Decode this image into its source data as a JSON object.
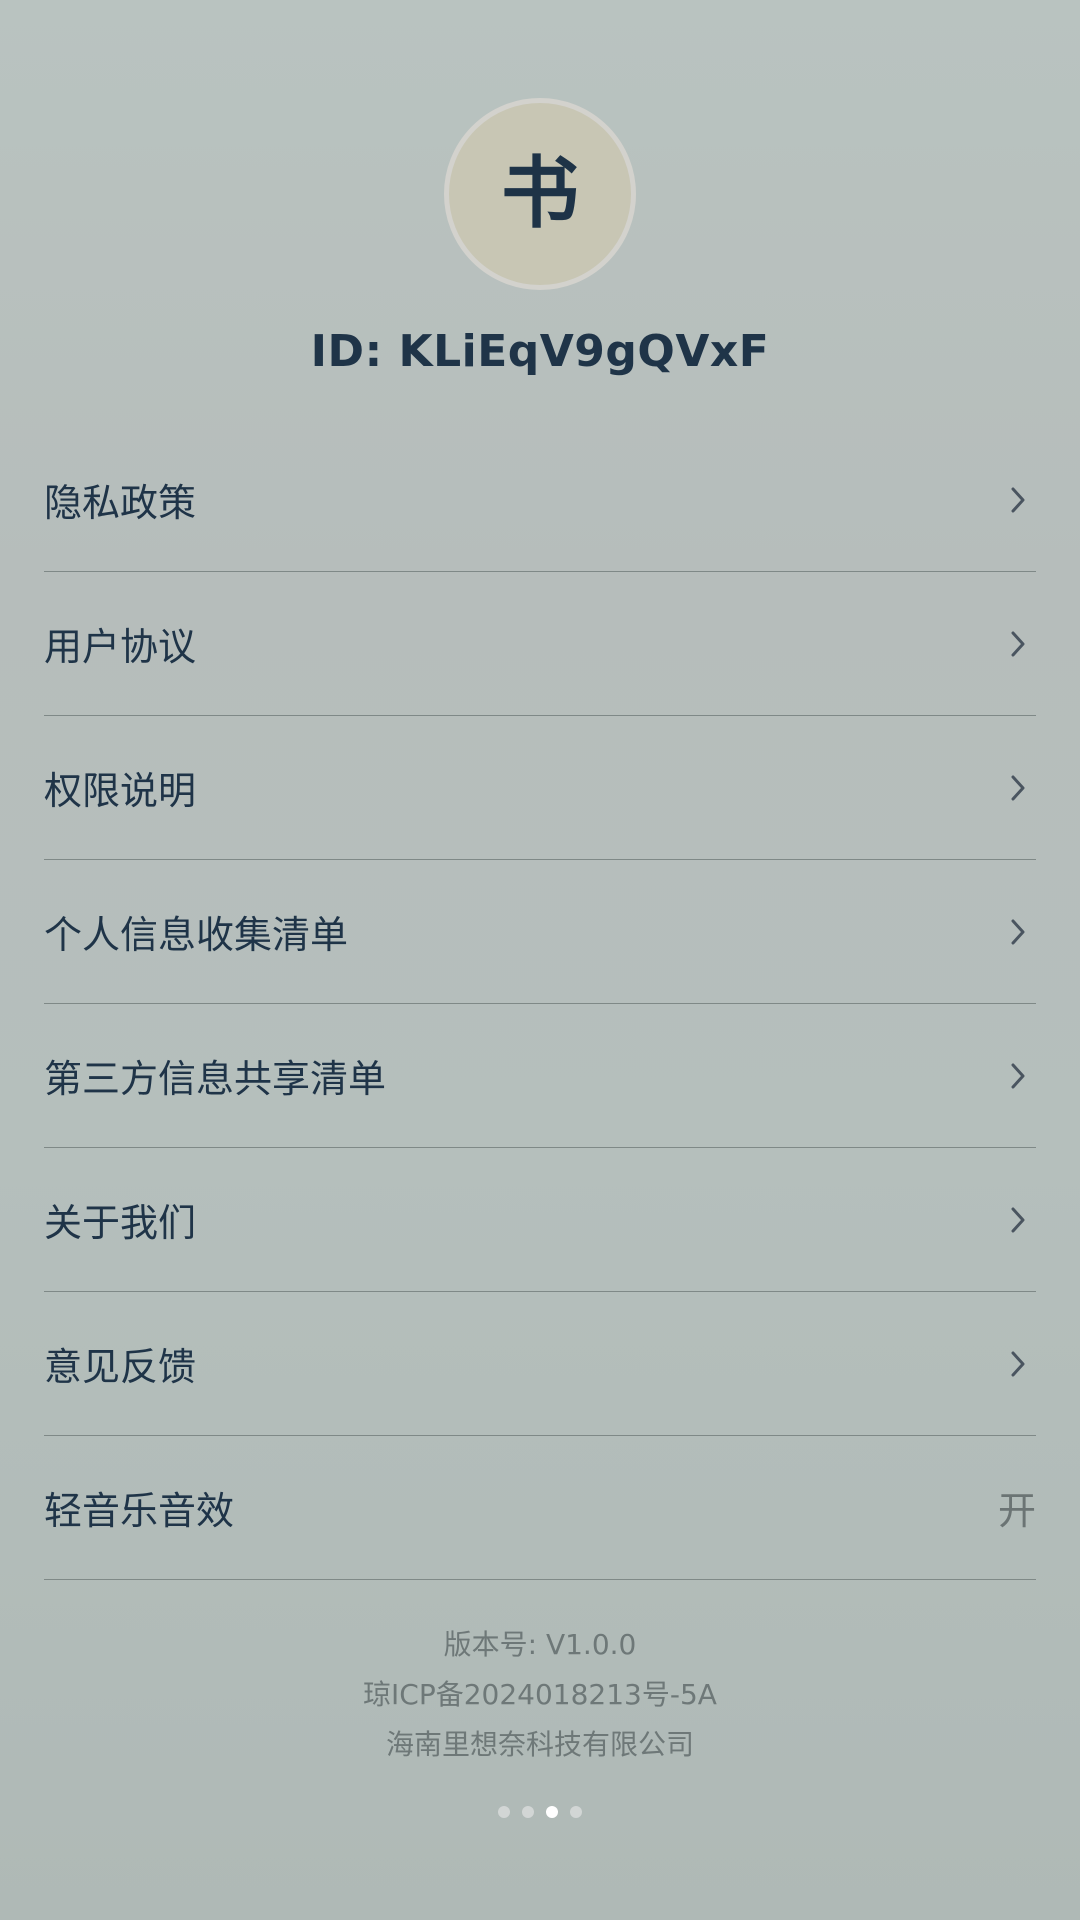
{
  "profile": {
    "avatar_char": "书",
    "id_text": "ID: KLiEqV9gQVxF"
  },
  "menu": {
    "items": [
      {
        "label": "隐私政策",
        "icon": "chevron-right-icon"
      },
      {
        "label": "用户协议",
        "icon": "chevron-right-icon"
      },
      {
        "label": "权限说明",
        "icon": "chevron-right-icon"
      },
      {
        "label": "个人信息收集清单",
        "icon": "chevron-right-icon"
      },
      {
        "label": "第三方信息共享清单",
        "icon": "chevron-right-icon"
      },
      {
        "label": "关于我们",
        "icon": "chevron-right-icon"
      },
      {
        "label": "意见反馈",
        "icon": "chevron-right-icon"
      }
    ],
    "music": {
      "label": "轻音乐音效",
      "value": "开"
    }
  },
  "footer": {
    "version": "版本号: V1.0.0",
    "icp": "琼ICP备2024018213号-5A",
    "company": "海南里想奈科技有限公司"
  },
  "page_indicator": {
    "count": 4,
    "active_index": 2
  },
  "colors": {
    "text_primary": "#1f3448",
    "text_secondary": "#6e7878",
    "avatar_bg": "#c8c6b4",
    "divider": "#7f8987"
  }
}
